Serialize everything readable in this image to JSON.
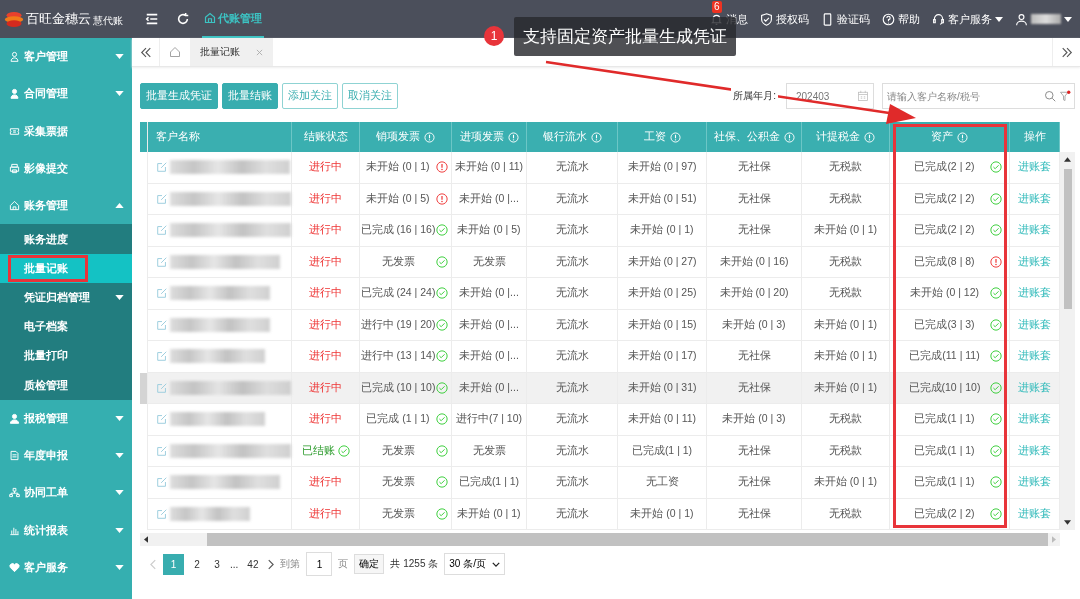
{
  "app": {
    "name": "百旺金穗云",
    "subtitle": "慧代账"
  },
  "top_tabs": [
    {
      "label": "代账管理",
      "selected": true
    }
  ],
  "top_links": [
    {
      "label": "消息",
      "badge": "6",
      "dropdown": false
    },
    {
      "label": "授权码",
      "dropdown": false
    },
    {
      "label": "验证码",
      "dropdown": false
    },
    {
      "label": "帮助",
      "dropdown": false
    },
    {
      "label": "客户服务",
      "dropdown": true
    }
  ],
  "user_menu": {
    "dropdown": true
  },
  "sidebar": {
    "items": [
      {
        "label": "客户管理",
        "expanded": false
      },
      {
        "label": "合同管理",
        "expanded": false
      },
      {
        "label": "采集票据"
      },
      {
        "label": "影像提交"
      },
      {
        "label": "账务管理",
        "expanded": true,
        "children": [
          {
            "label": "账务进度",
            "selected": false,
            "highlighted": false
          },
          {
            "label": "批量记账",
            "selected": true,
            "highlighted": true
          },
          {
            "label": "凭证归档管理",
            "selected": false,
            "highlighted": false,
            "expanded": false
          },
          {
            "label": "电子档案",
            "selected": false,
            "highlighted": false
          },
          {
            "label": "批量打印",
            "selected": false,
            "highlighted": false
          },
          {
            "label": "质检管理",
            "selected": false,
            "highlighted": false
          }
        ]
      },
      {
        "label": "报税管理",
        "expanded": false
      },
      {
        "label": "年度申报",
        "expanded": false
      },
      {
        "label": "协同工单",
        "expanded": false
      },
      {
        "label": "统计报表",
        "expanded": false
      },
      {
        "label": "客户服务",
        "expanded": false
      }
    ]
  },
  "page_tabs": [
    {
      "label": "批量记账",
      "selected": true,
      "closable": true
    }
  ],
  "toolbar": {
    "buttons": [
      {
        "label": "批量生成凭证",
        "kind": "primary"
      },
      {
        "label": "批量结账",
        "kind": "primary"
      },
      {
        "label": "添加关注",
        "kind": "outline"
      },
      {
        "label": "取消关注",
        "kind": "outline"
      }
    ],
    "period": {
      "label": "所属年月:",
      "value": "202403"
    },
    "search": {
      "placeholder": "请输入客户名称/税号"
    },
    "filter_active": true
  },
  "table": {
    "columns": [
      {
        "label": "客户名称",
        "info": false,
        "highlighted": false
      },
      {
        "label": "结账状态",
        "info": false,
        "highlighted": false
      },
      {
        "label": "销项发票",
        "info": true,
        "highlighted": false
      },
      {
        "label": "进项发票",
        "info": true,
        "highlighted": false
      },
      {
        "label": "银行流水",
        "info": true,
        "highlighted": false
      },
      {
        "label": "工资",
        "info": true,
        "highlighted": false
      },
      {
        "label": "社保、公积金",
        "info": true,
        "highlighted": false
      },
      {
        "label": "计提税金",
        "info": true,
        "highlighted": false
      },
      {
        "label": "资产",
        "info": true,
        "highlighted": true
      },
      {
        "label": "操作",
        "info": false,
        "highlighted": false
      }
    ],
    "rows": [
      {
        "hovered": false,
        "cells": [
          {
            "kind": "redacted"
          },
          {
            "text": "进行中",
            "kind": "open"
          },
          {
            "text": "未开始 (0 | 1)",
            "kind": "warn"
          },
          {
            "text": "未开始 (0 | 11)",
            "kind": "plain"
          },
          {
            "text": "无流水",
            "kind": "plain"
          },
          {
            "text": "未开始 (0 | 97)",
            "kind": "plain"
          },
          {
            "text": "无社保",
            "kind": "plain"
          },
          {
            "text": "无税款",
            "kind": "plain"
          },
          {
            "text": "已完成(2 | 2)",
            "kind": "ok"
          },
          {
            "text": "进账套",
            "kind": "link"
          }
        ]
      },
      {
        "hovered": false,
        "cells": [
          {
            "kind": "redacted"
          },
          {
            "text": "进行中",
            "kind": "open"
          },
          {
            "text": "未开始 (0 | 5)",
            "kind": "warn"
          },
          {
            "text": "未开始 (0 |...",
            "kind": "plain"
          },
          {
            "text": "无流水",
            "kind": "plain"
          },
          {
            "text": "未开始 (0 | 51)",
            "kind": "plain"
          },
          {
            "text": "无社保",
            "kind": "plain"
          },
          {
            "text": "无税款",
            "kind": "plain"
          },
          {
            "text": "已完成(2 | 2)",
            "kind": "ok"
          },
          {
            "text": "进账套",
            "kind": "link"
          }
        ]
      },
      {
        "hovered": false,
        "cells": [
          {
            "kind": "redacted"
          },
          {
            "text": "进行中",
            "kind": "open"
          },
          {
            "text": "已完成 (16 | 16)",
            "kind": "ok"
          },
          {
            "text": "未开始 (0 | 5)",
            "kind": "plain"
          },
          {
            "text": "无流水",
            "kind": "plain"
          },
          {
            "text": "未开始 (0 | 1)",
            "kind": "plain"
          },
          {
            "text": "无社保",
            "kind": "plain"
          },
          {
            "text": "未开始 (0 | 1)",
            "kind": "plain"
          },
          {
            "text": "已完成(2 | 2)",
            "kind": "ok"
          },
          {
            "text": "进账套",
            "kind": "link"
          }
        ]
      },
      {
        "hovered": false,
        "cells": [
          {
            "kind": "redacted"
          },
          {
            "text": "进行中",
            "kind": "open"
          },
          {
            "text": "无发票",
            "kind": "ok"
          },
          {
            "text": "无发票",
            "kind": "plain"
          },
          {
            "text": "无流水",
            "kind": "plain"
          },
          {
            "text": "未开始 (0 | 27)",
            "kind": "plain"
          },
          {
            "text": "未开始 (0 | 16)",
            "kind": "plain"
          },
          {
            "text": "无税款",
            "kind": "plain"
          },
          {
            "text": "已完成(8 | 8)",
            "kind": "warn"
          },
          {
            "text": "进账套",
            "kind": "link"
          }
        ]
      },
      {
        "hovered": false,
        "cells": [
          {
            "kind": "redacted"
          },
          {
            "text": "进行中",
            "kind": "open"
          },
          {
            "text": "已完成 (24 | 24)",
            "kind": "ok"
          },
          {
            "text": "未开始 (0 |...",
            "kind": "plain"
          },
          {
            "text": "无流水",
            "kind": "plain"
          },
          {
            "text": "未开始 (0 | 25)",
            "kind": "plain"
          },
          {
            "text": "未开始 (0 | 20)",
            "kind": "plain"
          },
          {
            "text": "无税款",
            "kind": "plain"
          },
          {
            "text": "未开始 (0 | 12)",
            "kind": "ok"
          },
          {
            "text": "进账套",
            "kind": "link"
          }
        ]
      },
      {
        "hovered": false,
        "cells": [
          {
            "kind": "redacted"
          },
          {
            "text": "进行中",
            "kind": "open"
          },
          {
            "text": "进行中 (19 | 20)",
            "kind": "ok"
          },
          {
            "text": "未开始 (0 |...",
            "kind": "plain"
          },
          {
            "text": "无流水",
            "kind": "plain"
          },
          {
            "text": "未开始 (0 | 15)",
            "kind": "plain"
          },
          {
            "text": "未开始 (0 | 3)",
            "kind": "plain"
          },
          {
            "text": "未开始 (0 | 1)",
            "kind": "plain"
          },
          {
            "text": "已完成(3 | 3)",
            "kind": "ok"
          },
          {
            "text": "进账套",
            "kind": "link"
          }
        ]
      },
      {
        "hovered": false,
        "cells": [
          {
            "kind": "redacted"
          },
          {
            "text": "进行中",
            "kind": "open"
          },
          {
            "text": "进行中 (13 | 14)",
            "kind": "ok"
          },
          {
            "text": "未开始 (0 |...",
            "kind": "plain"
          },
          {
            "text": "无流水",
            "kind": "plain"
          },
          {
            "text": "未开始 (0 | 17)",
            "kind": "plain"
          },
          {
            "text": "无社保",
            "kind": "plain"
          },
          {
            "text": "未开始 (0 | 1)",
            "kind": "plain"
          },
          {
            "text": "已完成(11 | 11)",
            "kind": "ok"
          },
          {
            "text": "进账套",
            "kind": "link"
          }
        ]
      },
      {
        "hovered": true,
        "cells": [
          {
            "kind": "redacted"
          },
          {
            "text": "进行中",
            "kind": "open"
          },
          {
            "text": "已完成 (10 | 10)",
            "kind": "ok"
          },
          {
            "text": "未开始 (0 |...",
            "kind": "plain"
          },
          {
            "text": "无流水",
            "kind": "plain"
          },
          {
            "text": "未开始 (0 | 31)",
            "kind": "plain"
          },
          {
            "text": "无社保",
            "kind": "plain"
          },
          {
            "text": "未开始 (0 | 1)",
            "kind": "plain"
          },
          {
            "text": "已完成(10 | 10)",
            "kind": "ok"
          },
          {
            "text": "进账套",
            "kind": "link"
          }
        ]
      },
      {
        "hovered": false,
        "cells": [
          {
            "kind": "redacted"
          },
          {
            "text": "进行中",
            "kind": "open"
          },
          {
            "text": "已完成 (1 | 1)",
            "kind": "ok"
          },
          {
            "text": "进行中(7 | 10)",
            "kind": "plain"
          },
          {
            "text": "无流水",
            "kind": "plain"
          },
          {
            "text": "未开始 (0 | 11)",
            "kind": "plain"
          },
          {
            "text": "未开始 (0 | 3)",
            "kind": "plain"
          },
          {
            "text": "无税款",
            "kind": "plain"
          },
          {
            "text": "已完成(1 | 1)",
            "kind": "ok"
          },
          {
            "text": "进账套",
            "kind": "link"
          }
        ]
      },
      {
        "hovered": false,
        "cells": [
          {
            "kind": "redacted"
          },
          {
            "text": "已结账",
            "kind": "closed"
          },
          {
            "text": "无发票",
            "kind": "ok"
          },
          {
            "text": "无发票",
            "kind": "plain"
          },
          {
            "text": "无流水",
            "kind": "plain"
          },
          {
            "text": "已完成(1 | 1)",
            "kind": "plain"
          },
          {
            "text": "无社保",
            "kind": "plain"
          },
          {
            "text": "无税款",
            "kind": "plain"
          },
          {
            "text": "已完成(1 | 1)",
            "kind": "ok"
          },
          {
            "text": "进账套",
            "kind": "link"
          }
        ]
      },
      {
        "hovered": false,
        "cells": [
          {
            "kind": "redacted"
          },
          {
            "text": "进行中",
            "kind": "open"
          },
          {
            "text": "无发票",
            "kind": "ok"
          },
          {
            "text": "已完成(1 | 1)",
            "kind": "plain"
          },
          {
            "text": "无流水",
            "kind": "plain"
          },
          {
            "text": "无工资",
            "kind": "plain"
          },
          {
            "text": "无社保",
            "kind": "plain"
          },
          {
            "text": "未开始 (0 | 1)",
            "kind": "plain"
          },
          {
            "text": "已完成(1 | 1)",
            "kind": "ok"
          },
          {
            "text": "进账套",
            "kind": "link"
          }
        ]
      },
      {
        "hovered": false,
        "cells": [
          {
            "kind": "redacted"
          },
          {
            "text": "进行中",
            "kind": "open"
          },
          {
            "text": "无发票",
            "kind": "ok"
          },
          {
            "text": "未开始 (0 | 1)",
            "kind": "plain"
          },
          {
            "text": "无流水",
            "kind": "plain"
          },
          {
            "text": "未开始 (0 | 1)",
            "kind": "plain"
          },
          {
            "text": "无社保",
            "kind": "plain"
          },
          {
            "text": "无税款",
            "kind": "plain"
          },
          {
            "text": "已完成(2 | 2)",
            "kind": "ok"
          },
          {
            "text": "进账套",
            "kind": "link"
          }
        ]
      }
    ]
  },
  "pagination": {
    "pages": [
      {
        "label": "1",
        "kind": "page",
        "selected": true
      },
      {
        "label": "2",
        "kind": "page",
        "selected": false
      },
      {
        "label": "3",
        "kind": "page",
        "selected": false
      },
      {
        "label": "...",
        "kind": "gap"
      },
      {
        "label": "42",
        "kind": "page",
        "selected": false
      }
    ],
    "goto_label": "到第",
    "goto_value": "1",
    "goto_unit": "页",
    "confirm": "确定",
    "total": "共 1255 条",
    "page_size": "30 条/页"
  },
  "callout": {
    "number": "1",
    "text": "支持固定资产批量生成凭证"
  }
}
